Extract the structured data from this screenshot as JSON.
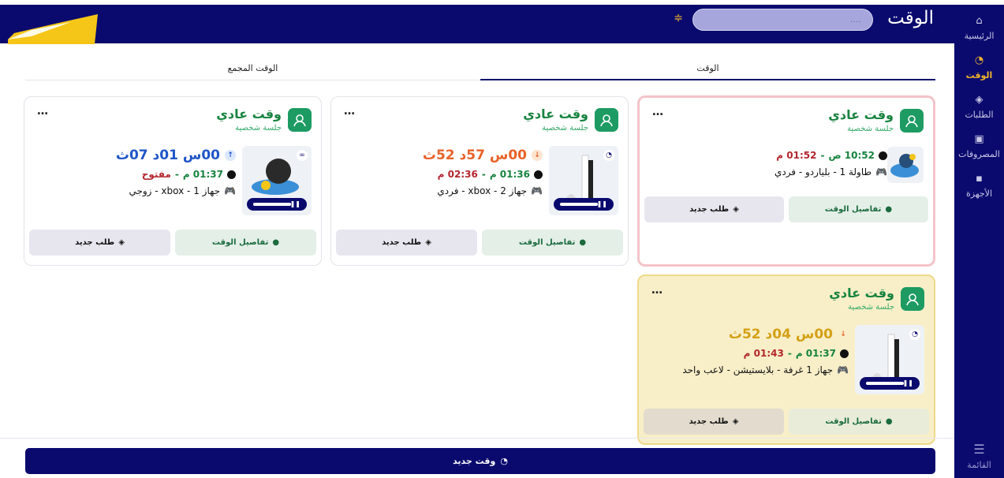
{
  "header": {
    "title": "الوقت",
    "search_placeholder": "...."
  },
  "sidebar": {
    "items": [
      {
        "label": "الرئيسية",
        "icon": "home-icon"
      },
      {
        "label": "الوقت",
        "icon": "stopwatch-icon"
      },
      {
        "label": "الطلبات",
        "icon": "box-icon"
      },
      {
        "label": "المصروفات",
        "icon": "money-icon"
      },
      {
        "label": "الأجهزة",
        "icon": "device-icon"
      }
    ],
    "menu_label": "القائمة"
  },
  "tabs": [
    {
      "label": "الوقت",
      "active": true
    },
    {
      "label": "الوقت المجمع",
      "active": false
    }
  ],
  "cards": [
    {
      "title": "وقت عادي",
      "subtitle": "جلسة شخصية",
      "duration": "00س 01د 07ث",
      "duration_color": "#1f55c7",
      "start": "01:37 م",
      "end": "مفتوح",
      "device": "جهاز 1 - xbox - زوجي",
      "badge": "∞"
    },
    {
      "title": "وقت عادي",
      "subtitle": "جلسة شخصية",
      "duration": "00س 57د 52ث",
      "duration_color": "#e8622a",
      "start": "01:36 م",
      "end": "02:36 م",
      "device": "جهاز 2 - xbox - فردي"
    },
    {
      "title": "وقت عادي",
      "subtitle": "جلسة شخصية",
      "start": "10:52 ص",
      "end": "01:52 م",
      "device": "طاولة 1 - بلياردو - فردي"
    },
    {
      "title": "وقت عادي",
      "subtitle": "جلسة شخصية",
      "duration": "00س 04د 52ث",
      "duration_color": "#d4a017",
      "start": "01:37 م",
      "end": "01:43 م",
      "device": "جهاز 1 غرفة - بلايستيشن - لاعب واحد"
    }
  ],
  "buttons": {
    "details": "تفاصيل الوقت",
    "order": "طلب جديد",
    "new_time": "وقت جديد"
  },
  "colors": {
    "navy": "#0a0a6e",
    "accent": "#f0b429",
    "green": "#18833f",
    "red": "#b3262e"
  }
}
